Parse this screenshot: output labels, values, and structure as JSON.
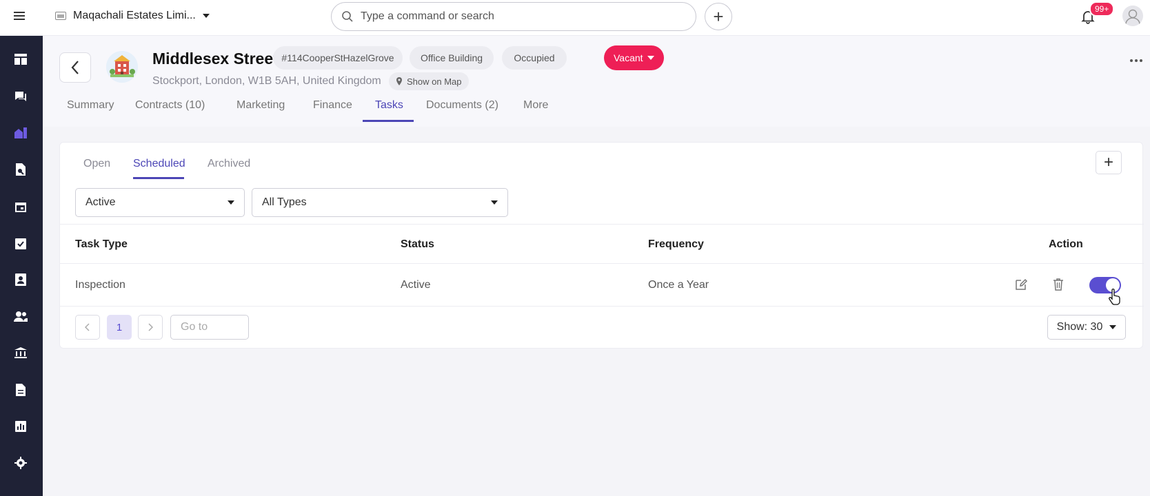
{
  "topbar": {
    "company_name": "Maqachali Estates Limi...",
    "search_placeholder": "Type a command or search",
    "notifications_count": "99+"
  },
  "sidebar": {
    "items": [
      "dashboard-icon",
      "chat-icon",
      "properties-icon",
      "search-document-icon",
      "calendar-icon",
      "checklist-icon",
      "contacts-icon",
      "people-icon",
      "bank-icon",
      "document-icon",
      "reports-icon",
      "settings-icon"
    ],
    "active_color": "#6d5be0"
  },
  "property": {
    "title": "Middlesex Street",
    "reference": "#114CooperStHazelGrove",
    "type": "Office Building",
    "occupancy": "Occupied",
    "status": "Vacant",
    "address": "Stockport, London, W1B 5AH, United Kingdom",
    "map_label": "Show on Map"
  },
  "tabs": [
    "Summary",
    "Contracts (10)",
    "Marketing",
    "Finance",
    "Tasks",
    "Documents (2)",
    "More"
  ],
  "active_tab": "Tasks",
  "subtabs": [
    "Open",
    "Scheduled",
    "Archived"
  ],
  "active_subtab": "Scheduled",
  "filters": {
    "status": "Active",
    "type": "All Types"
  },
  "table": {
    "columns": [
      "Task Type",
      "Status",
      "Frequency",
      "Action"
    ],
    "rows": [
      {
        "task_type": "Inspection",
        "status": "Active",
        "frequency": "Once a Year",
        "enabled": true
      }
    ]
  },
  "pagination": {
    "current_page": "1",
    "goto_placeholder": "Go to",
    "page_size": "Show: 30"
  },
  "colors": {
    "accent": "#4c46b6",
    "vacant": "#ee1f56",
    "sidebar_bg": "#1f2236"
  }
}
